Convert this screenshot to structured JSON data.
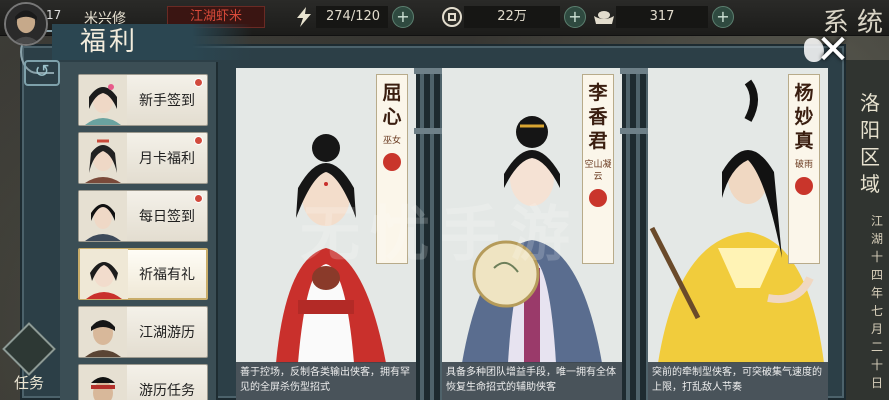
{
  "hud": {
    "level": "17",
    "player_name": "米兴修",
    "title_badge": "江湖虾米",
    "stamina": "274/120",
    "coins": "22万",
    "ingots": "317"
  },
  "top_right_label": "系 统",
  "panel": {
    "title": "福利"
  },
  "sidebar": {
    "items": [
      {
        "label": "新手签到",
        "has_dot": true
      },
      {
        "label": "月卡福利",
        "has_dot": true
      },
      {
        "label": "每日签到",
        "has_dot": true
      },
      {
        "label": "祈福有礼",
        "has_dot": false,
        "active": true
      },
      {
        "label": "江湖游历",
        "has_dot": false
      },
      {
        "label": "游历任务",
        "has_dot": false
      }
    ]
  },
  "mission_button": "任务",
  "cards": [
    {
      "name_chars": [
        "屈",
        "心"
      ],
      "sect": "巫女",
      "description": "善于控场，反制各类输出侠客，拥有罕见的全屏杀伤型招式",
      "colors": {
        "robe": "#c9302c",
        "inner": "#ffffff"
      }
    },
    {
      "name_chars": [
        "李",
        "香",
        "君"
      ],
      "sect": "空山凝云",
      "description": "具备多种团队增益手段，唯一拥有全体恢复生命招式的辅助侠客",
      "colors": {
        "robe": "#5a6d8f",
        "inner": "#e7e3f0"
      }
    },
    {
      "name_chars": [
        "杨",
        "妙",
        "真"
      ],
      "sect": "破雨",
      "description": "突前的牵制型侠客，可突破集气速度的上限，打乱敌人节奏",
      "colors": {
        "robe": "#f1cc3c",
        "inner": "#fff3b5"
      }
    }
  ],
  "right_vertical": {
    "place": "洛阳区域",
    "date": "江湖十四年七月二十日"
  },
  "watermark": "无忧手游"
}
